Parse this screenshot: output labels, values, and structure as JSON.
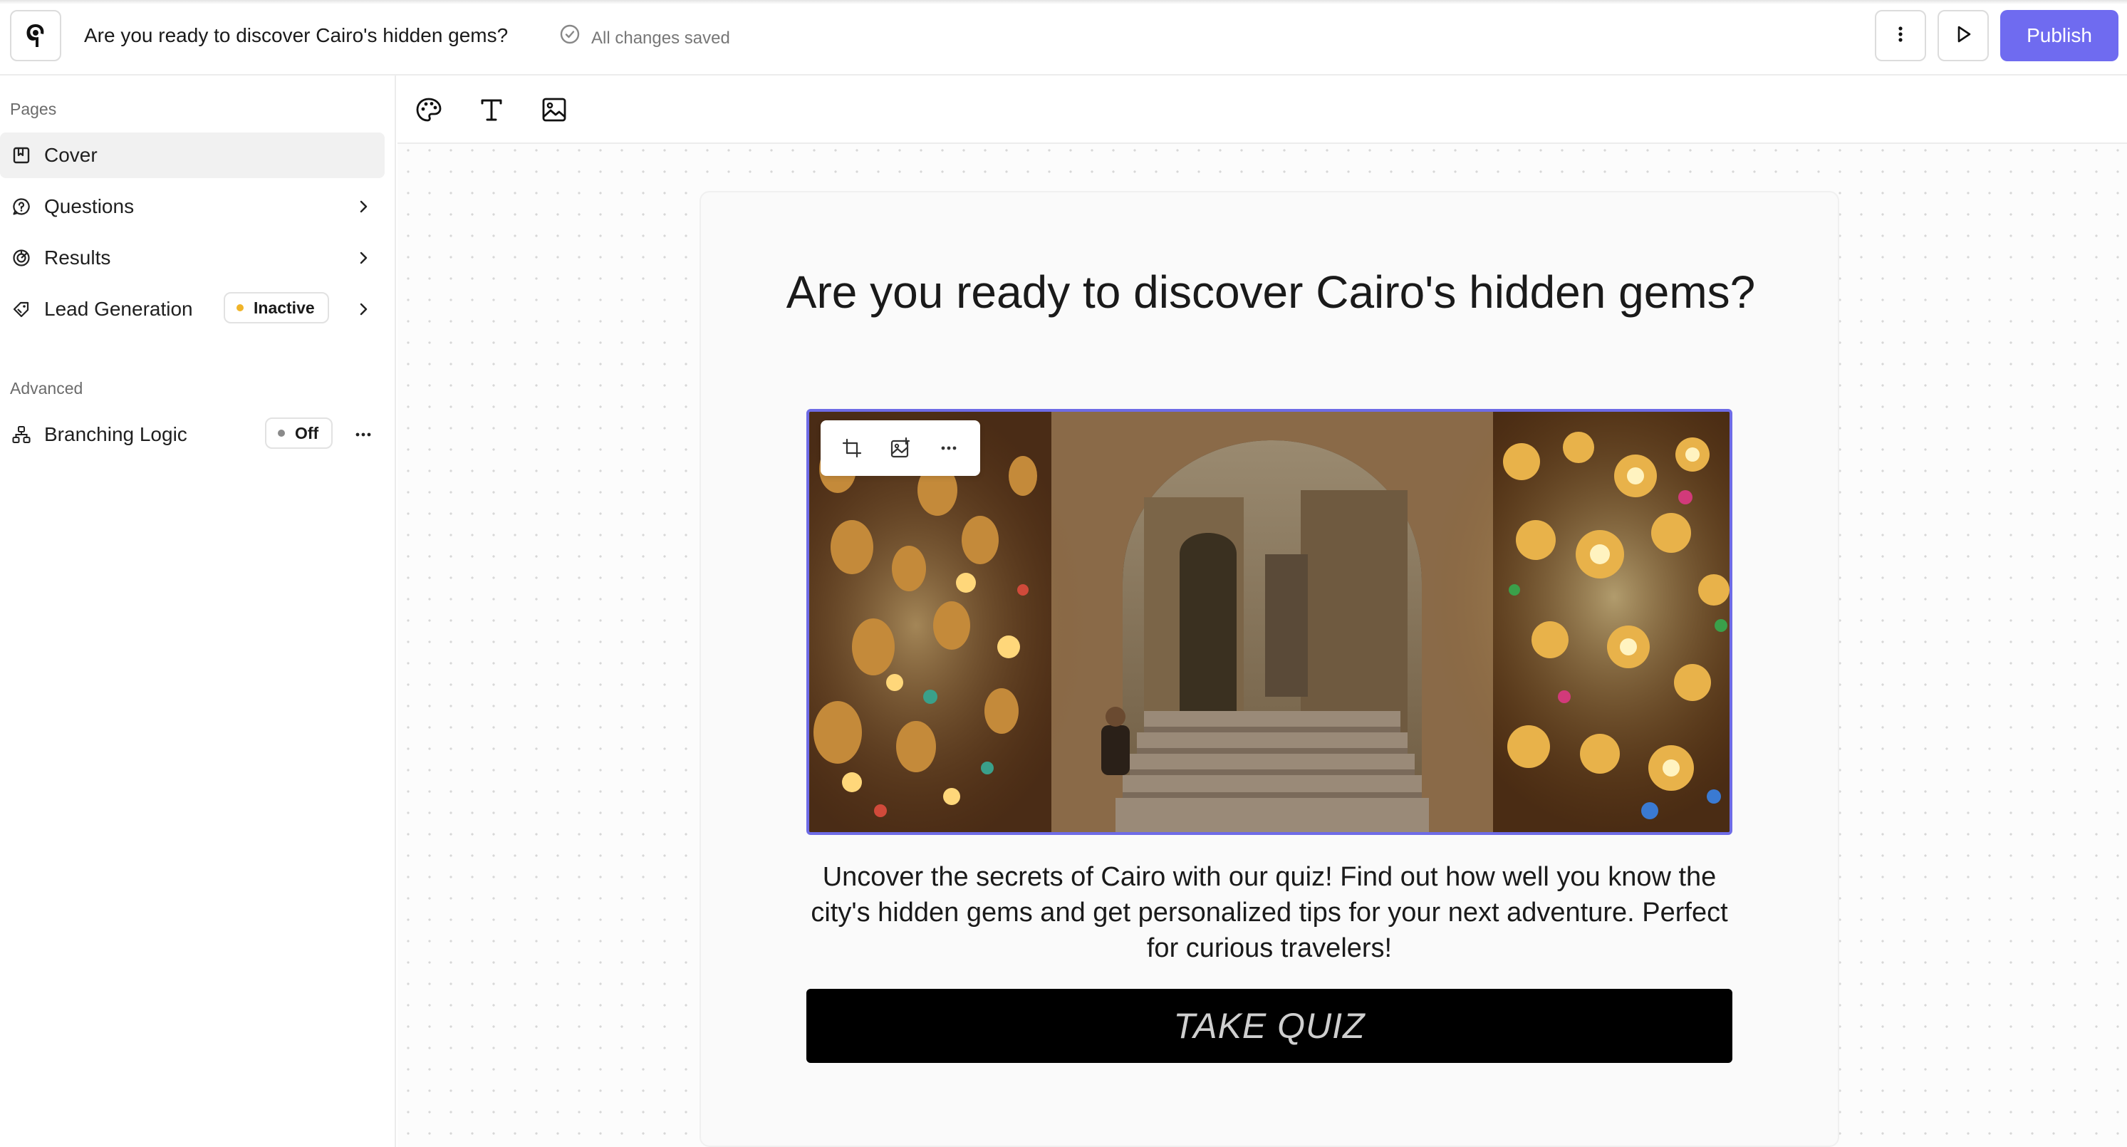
{
  "header": {
    "title": "Are you ready to discover Cairo's hidden gems?",
    "save_status": "All changes saved",
    "publish_label": "Publish",
    "icons": {
      "logo": "brand-logo-icon",
      "saved": "check-circle-icon",
      "more": "more-vertical-icon",
      "preview": "play-icon"
    }
  },
  "sidebar": {
    "pages_label": "Pages",
    "pages": [
      {
        "label": "Cover",
        "icon": "cover-icon",
        "active": true
      },
      {
        "label": "Questions",
        "icon": "question-bubble-icon"
      },
      {
        "label": "Results",
        "icon": "results-chart-icon"
      },
      {
        "label": "Lead Generation",
        "icon": "lead-tag-icon",
        "badge": "Inactive",
        "badge_color": "#f0b429"
      }
    ],
    "advanced_label": "Advanced",
    "advanced": [
      {
        "label": "Branching Logic",
        "icon": "branching-icon",
        "badge": "Off",
        "badge_color": "#8a8a8a"
      }
    ]
  },
  "toolbar": {
    "tools": [
      "palette-icon",
      "text-icon",
      "image-icon"
    ]
  },
  "cover": {
    "title": "Are you ready to discover Cairo's hidden gems?",
    "image_toolbar": [
      "crop-icon",
      "replace-image-icon",
      "more-horizontal-icon"
    ],
    "description": "Uncover the secrets of Cairo with our quiz! Find out how well you know the city's hidden gems and get personalized tips for your next adventure. Perfect for curious travelers!",
    "cta_label": "TAKE QUIZ"
  },
  "colors": {
    "accent": "#6f6bf0",
    "selection": "#6e6be6",
    "cta_background": "#000000"
  }
}
